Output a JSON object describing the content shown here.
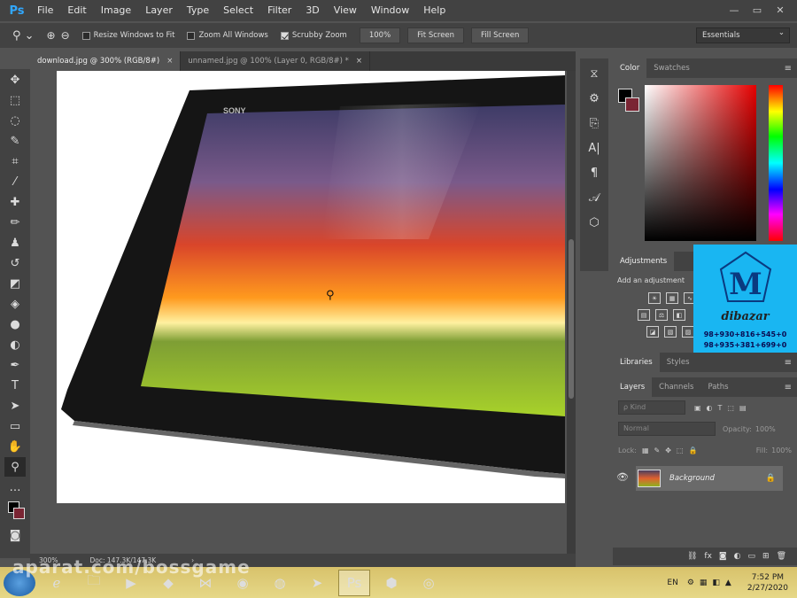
{
  "app": {
    "logo": "Ps"
  },
  "menu": [
    "File",
    "Edit",
    "Image",
    "Layer",
    "Type",
    "Select",
    "Filter",
    "3D",
    "View",
    "Window",
    "Help"
  ],
  "window_controls": [
    "—",
    "▭",
    "✕"
  ],
  "options": {
    "resize_windows": "Resize Windows to Fit",
    "zoom_all": "Zoom All Windows",
    "scrubby_zoom": "Scrubby Zoom",
    "zoom_value": "100%",
    "fit_screen": "Fit Screen",
    "fill_screen": "Fill Screen",
    "workspace": "Essentials"
  },
  "tabs": [
    {
      "label": "download.jpg @ 300% (RGB/8#)",
      "close": "×"
    },
    {
      "label": "unnamed.jpg @ 100% (Layer 0, RGB/8#) *",
      "close": "×"
    }
  ],
  "canvas": {
    "brand_label": "SONY"
  },
  "status": {
    "zoom": "300%",
    "doc": "Doc: 147.3K/147.3K",
    "arrow": "›"
  },
  "color_panel": {
    "tabs": [
      "Color",
      "Swatches"
    ]
  },
  "adjustments": {
    "tab": "Adjustments",
    "hint": "Add an adjustment"
  },
  "brand": {
    "name": "dibazar",
    "phone1": "98+930+816+545+0",
    "phone2": "98+935+381+699+0"
  },
  "libraries": {
    "tabs": [
      "Libraries",
      "Styles"
    ]
  },
  "layers": {
    "tabs": [
      "Layers",
      "Channels",
      "Paths"
    ],
    "kind_label": "ρ Kind",
    "blend": "Normal",
    "opacity_label": "Opacity:",
    "opacity_value": "100%",
    "lock_label": "Lock:",
    "fill_label": "Fill:",
    "fill_value": "100%",
    "layer_name": "Background"
  },
  "taskbar": {
    "watermark": "aparat.com/bossgame",
    "lang": "EN",
    "time": "7:52 PM",
    "date": "2/27/2020"
  }
}
